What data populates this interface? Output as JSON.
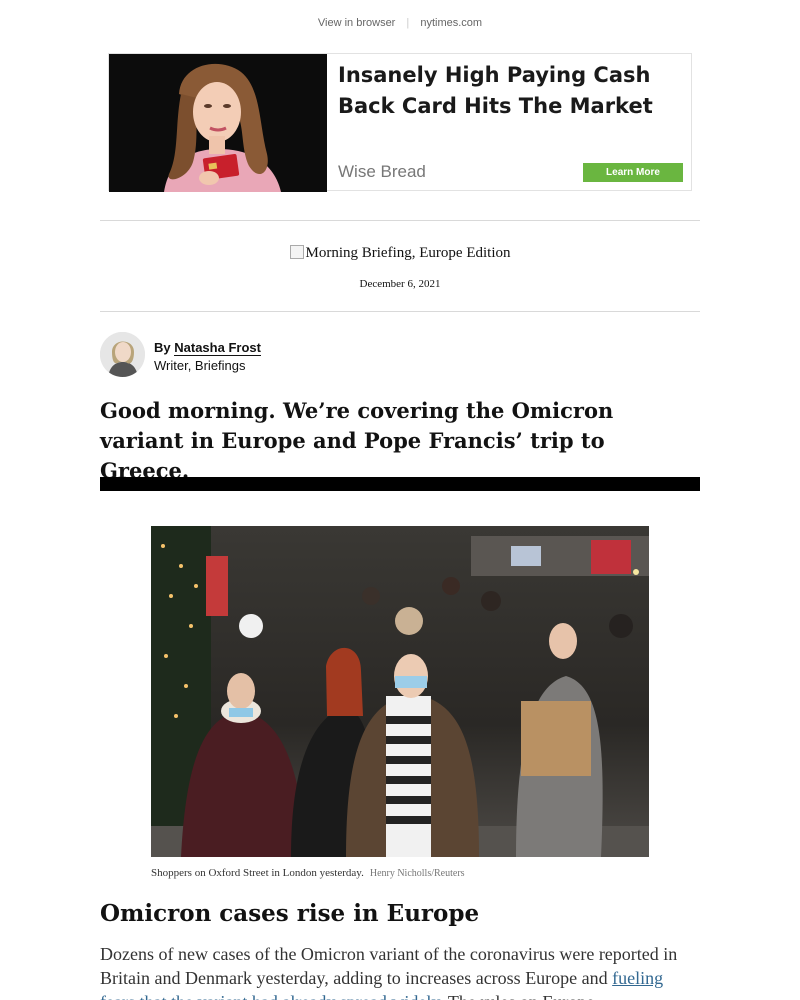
{
  "header": {
    "view_in_browser": "View in browser",
    "separator": "|",
    "site": "nytimes.com"
  },
  "ad": {
    "headline": "Insanely High Paying Cash Back Card Hits The Market",
    "brand": "Wise Bread",
    "cta": "Learn More",
    "cta_color": "#6ab640"
  },
  "newsletter": {
    "masthead_alt": "Morning Briefing, Europe Edition",
    "date": "December 6, 2021"
  },
  "author": {
    "by": "By",
    "name": "Natasha Frost",
    "role": "Writer, Briefings"
  },
  "intro": "Good morning. We’re covering the Omicron variant in Europe and Pope Francis’ trip to Greece.",
  "photo": {
    "caption": "Shoppers on Oxford Street in London yesterday.",
    "credit": "Henry Nicholls/Reuters"
  },
  "story": {
    "headline": "Omicron cases rise in Europe",
    "body_start": "Dozens of new cases of the Omicron variant of the coronavirus were reported in Britain and Denmark yesterday, adding to increases across Europe and ",
    "link_text": "fueling fears that the variant had already spread widely",
    "body_end": ". The rules on Europe"
  },
  "colors": {
    "link": "#326891",
    "rule": "#d9d9d9"
  }
}
